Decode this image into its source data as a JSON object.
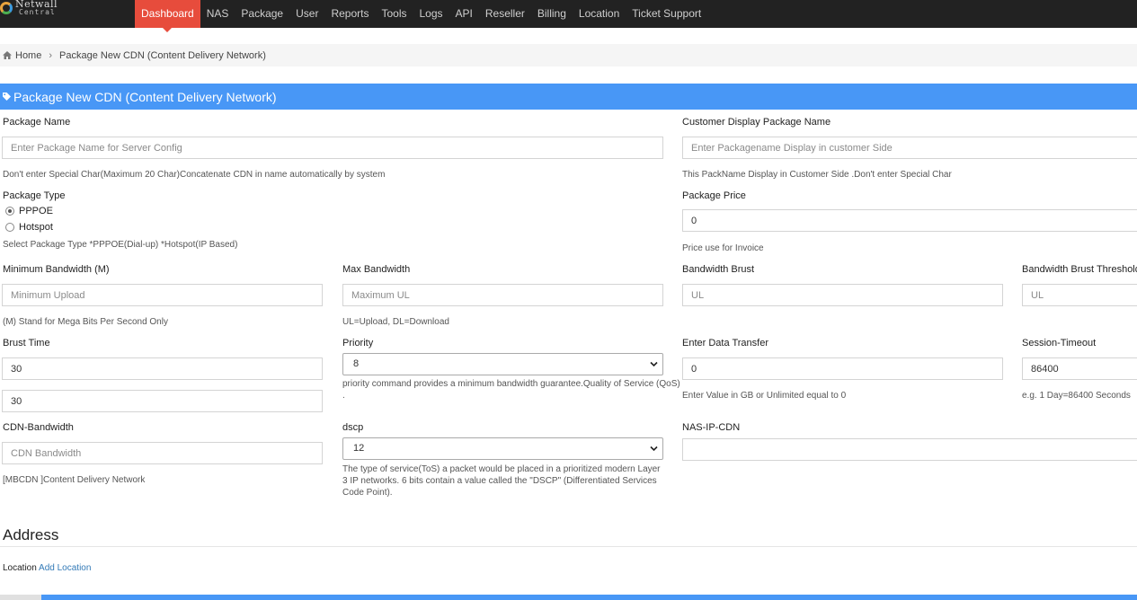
{
  "brand": {
    "line1": "Netwall",
    "line2": "Central"
  },
  "nav": [
    "Dashboard",
    "NAS",
    "Package",
    "User",
    "Reports",
    "Tools",
    "Logs",
    "API",
    "Reseller",
    "Billing",
    "Location",
    "Ticket Support"
  ],
  "breadcrumb": {
    "home": "Home",
    "separator": "›",
    "current": "Package New CDN (Content Delivery Network)"
  },
  "panel_title": "Package New CDN (Content Delivery Network)",
  "form": {
    "package_name": {
      "label": "Package Name",
      "placeholder": "Enter Package Name for Server Config",
      "help": "Don't enter Special Char(Maximum 20 Char)Concatenate CDN in name automatically by system"
    },
    "customer_display": {
      "label": "Customer Display Package Name",
      "placeholder": "Enter Packagename Display in customer Side",
      "help": "This PackName Display in Customer Side .Don't enter Special Char"
    },
    "package_type": {
      "label": "Package Type",
      "options": [
        "PPPOE",
        "Hotspot"
      ],
      "selected": "PPPOE",
      "help": "Select Package Type *PPPOE(Dial-up) *Hotspot(IP Based)"
    },
    "package_price": {
      "label": "Package Price",
      "value": "0",
      "help": "Price use for Invoice"
    },
    "min_bandwidth": {
      "label": "Minimum Bandwidth (M)",
      "placeholder": "Minimum Upload",
      "help": "(M) Stand for Mega Bits Per Second Only"
    },
    "max_bandwidth": {
      "label": "Max Bandwidth",
      "placeholder": "Maximum UL",
      "help": "UL=Upload, DL=Download"
    },
    "bandwidth_brust": {
      "label": "Bandwidth Brust",
      "placeholder": "UL"
    },
    "brust_threshold": {
      "label": "Bandwidth Brust Threshold",
      "placeholder": "UL"
    },
    "brust_time": {
      "label": "Brust Time",
      "value1": "30",
      "value2": "30"
    },
    "priority": {
      "label": "Priority",
      "value": "8",
      "help": "priority command provides a minimum bandwidth guarantee.Quality of Service (QoS)",
      "help2": "."
    },
    "data_transfer": {
      "label": "Enter Data Transfer",
      "value": "0",
      "help": "Enter Value in GB or Unlimited equal to 0"
    },
    "session_timeout": {
      "label": "Session-Timeout",
      "value": "86400",
      "help": "e.g. 1 Day=86400 Seconds"
    },
    "cdn_bandwidth": {
      "label": "CDN-Bandwidth",
      "placeholder": "CDN Bandwidth",
      "help": "[MBCDN ]Content Delivery Network"
    },
    "dscp": {
      "label": "dscp",
      "value": "12",
      "help": "The type of service(ToS) a packet would be placed in a prioritized modern Layer 3 IP networks. 6 bits contain a value called the \"DSCP\" (Differentiated Services Code Point)."
    },
    "nas_ip_cdn": {
      "label": "NAS-IP-CDN",
      "value": ""
    }
  },
  "address": {
    "title": "Address",
    "location_label": "Location",
    "add_location_link": "Add Location"
  },
  "colors": {
    "navbar": "#222222",
    "active_tab": "#e74c3c",
    "panel_header": "#4897f6",
    "link": "#337ab7"
  }
}
